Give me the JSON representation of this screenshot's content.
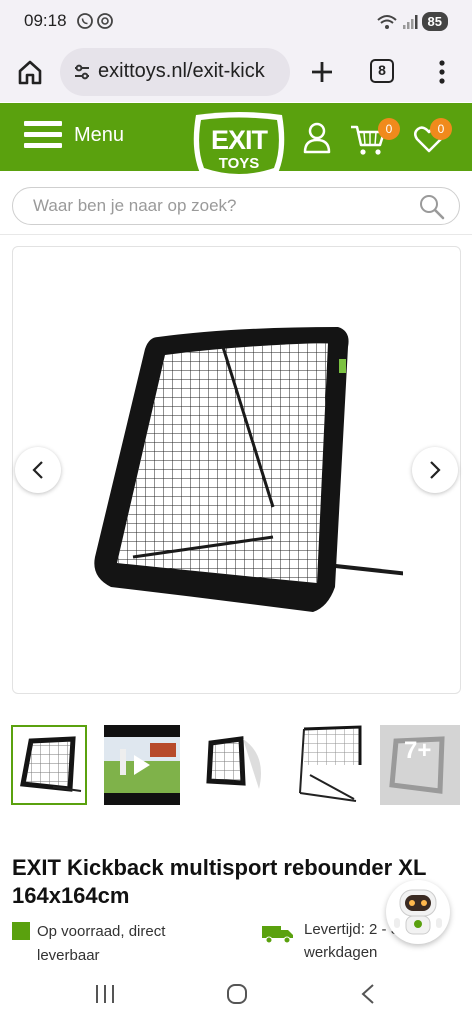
{
  "status_bar": {
    "time": "09:18",
    "battery": "85",
    "icons": [
      "whatsapp-icon",
      "at-sign-icon",
      "wifi-icon",
      "signal-icon",
      "battery-icon"
    ]
  },
  "browser": {
    "url": "exittoys.nl/exit-kick",
    "tab_count": "8",
    "icons": [
      "home-icon",
      "site-info-icon",
      "plus-icon",
      "tabs-icon",
      "more-vert-icon"
    ]
  },
  "header": {
    "menu_label": "Menu",
    "logo_top": "EXIT",
    "logo_bottom": "TOYS",
    "cart_count": "0",
    "wishlist_count": "0",
    "brand_color": "#5aa10e",
    "badge_color": "#f08a1c"
  },
  "search": {
    "placeholder": "Waar ben je naar op zoek?"
  },
  "gallery": {
    "more_label": "7+",
    "thumbnail_count": 5,
    "active_thumbnail": 1
  },
  "product": {
    "title": "EXIT Kickback multisport rebounder XL 164x164cm",
    "stock_text": "Op voorraad, direct leverbaar",
    "delivery_text": "Levertijd: 2 - 3 werkdagen"
  }
}
